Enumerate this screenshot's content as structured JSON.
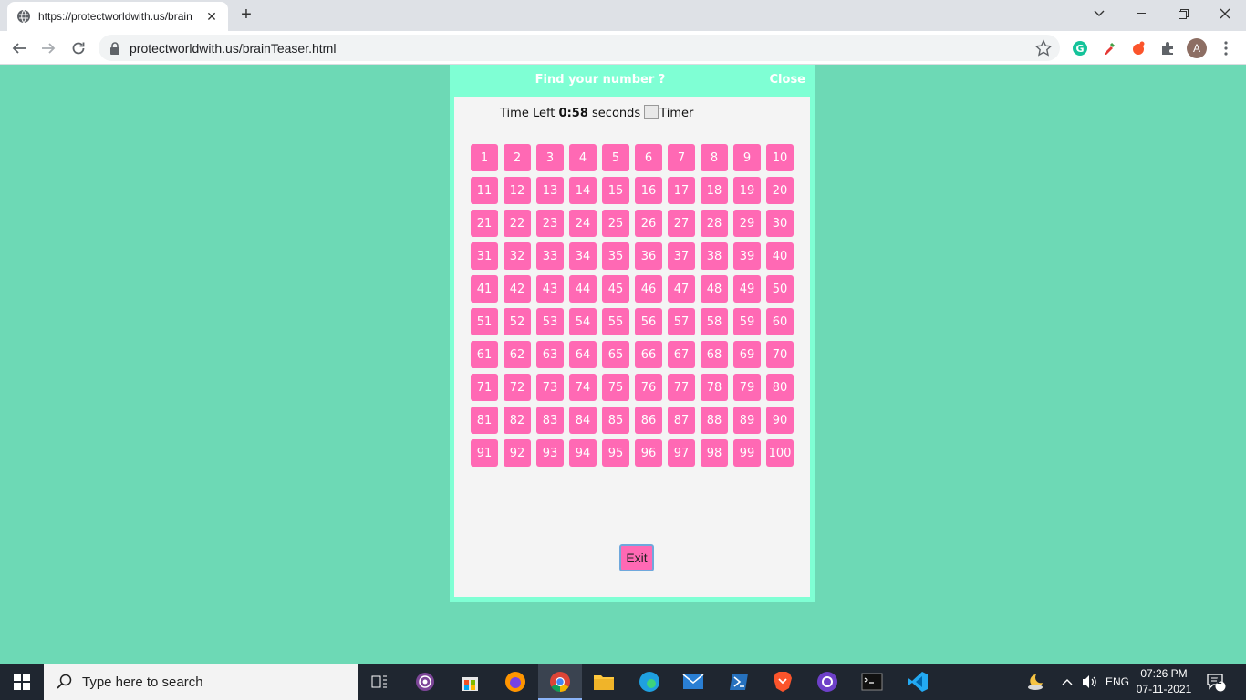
{
  "browser": {
    "tab_title": "https://protectworldwith.us/brain",
    "url": "protectworldwith.us/brainTeaser.html",
    "profile_initial": "A"
  },
  "modal": {
    "title": "Find your number ?",
    "close_label": "Close",
    "timer_prefix": "Time Left",
    "timer_value": "0:58",
    "timer_suffix": "seconds",
    "timer_img_alt": "Timer",
    "numbers": [
      "1",
      "2",
      "3",
      "4",
      "5",
      "6",
      "7",
      "8",
      "9",
      "10",
      "11",
      "12",
      "13",
      "14",
      "15",
      "16",
      "17",
      "18",
      "19",
      "20",
      "21",
      "22",
      "23",
      "24",
      "25",
      "26",
      "27",
      "28",
      "29",
      "30",
      "31",
      "32",
      "33",
      "34",
      "35",
      "36",
      "37",
      "38",
      "39",
      "40",
      "41",
      "42",
      "43",
      "44",
      "45",
      "46",
      "47",
      "48",
      "49",
      "50",
      "51",
      "52",
      "53",
      "54",
      "55",
      "56",
      "57",
      "58",
      "59",
      "60",
      "61",
      "62",
      "63",
      "64",
      "65",
      "66",
      "67",
      "68",
      "69",
      "70",
      "71",
      "72",
      "73",
      "74",
      "75",
      "76",
      "77",
      "78",
      "79",
      "80",
      "81",
      "82",
      "83",
      "84",
      "85",
      "86",
      "87",
      "88",
      "89",
      "90",
      "91",
      "92",
      "93",
      "94",
      "95",
      "96",
      "97",
      "98",
      "99",
      "100"
    ],
    "exit_label": "Exit"
  },
  "taskbar": {
    "search_placeholder": "Type here to search",
    "language": "ENG",
    "time": "07:26 PM",
    "date": "07-11-2021",
    "notification_count": "2"
  },
  "colors": {
    "page_bg": "#6dd9b5",
    "modal_frame": "#7fffd4",
    "number_tile": "#ff69b4"
  }
}
